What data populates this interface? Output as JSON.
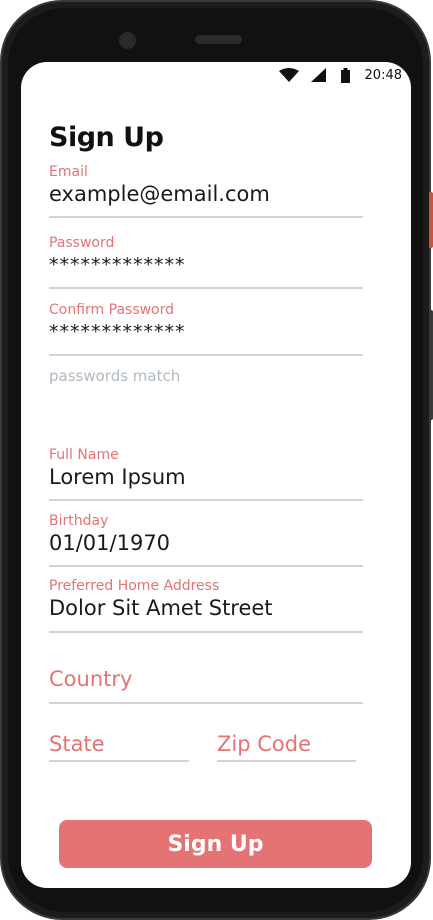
{
  "status_bar": {
    "time": "20:48",
    "icons": [
      "wifi-icon",
      "cellular-signal-icon",
      "battery-icon"
    ]
  },
  "form": {
    "title": "Sign Up",
    "email": {
      "label": "Email",
      "value": "example@email.com"
    },
    "password": {
      "label": "Password",
      "value": "*************"
    },
    "confirm_password": {
      "label": "Confirm Password",
      "value": "*************"
    },
    "password_hint": "passwords match",
    "full_name": {
      "label": "Full Name",
      "value": "Lorem Ipsum"
    },
    "birthday": {
      "label": "Birthday",
      "value": "01/01/1970"
    },
    "address": {
      "label": "Preferred Home Address",
      "value": "Dolor Sit Amet Street"
    },
    "country": {
      "placeholder": "Country"
    },
    "state": {
      "placeholder": "State"
    },
    "zip": {
      "placeholder": "Zip Code"
    },
    "submit_label": "Sign Up"
  },
  "colors": {
    "accent": "#e57373",
    "hint": "#b0b8c1",
    "underline": "#d3d3d3",
    "text": "#1a1a1a"
  }
}
